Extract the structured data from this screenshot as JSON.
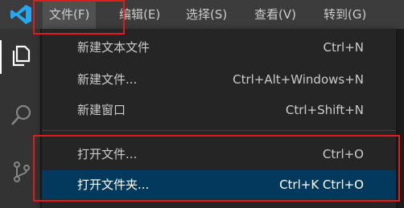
{
  "menubar": {
    "items": [
      {
        "label": "文件(F)"
      },
      {
        "label": "编辑(E)"
      },
      {
        "label": "选择(S)"
      },
      {
        "label": "查看(V)"
      },
      {
        "label": "转到(G)"
      }
    ]
  },
  "file_menu": {
    "items": [
      {
        "label": "新建文本文件",
        "shortcut": "Ctrl+N"
      },
      {
        "label": "新建文件...",
        "shortcut": "Ctrl+Alt+Windows+N"
      },
      {
        "label": "新建窗口",
        "shortcut": "Ctrl+Shift+N"
      },
      {
        "label": "打开文件...",
        "shortcut": "Ctrl+O"
      },
      {
        "label": "打开文件夹...",
        "shortcut": "Ctrl+K Ctrl+O"
      }
    ]
  },
  "colors": {
    "highlight": "#04395e",
    "annotation": "#e01b1b",
    "vscode_blue": "#23a9f2"
  },
  "icons": [
    "vscode-logo-icon",
    "files-icon",
    "search-icon",
    "source-control-icon"
  ]
}
